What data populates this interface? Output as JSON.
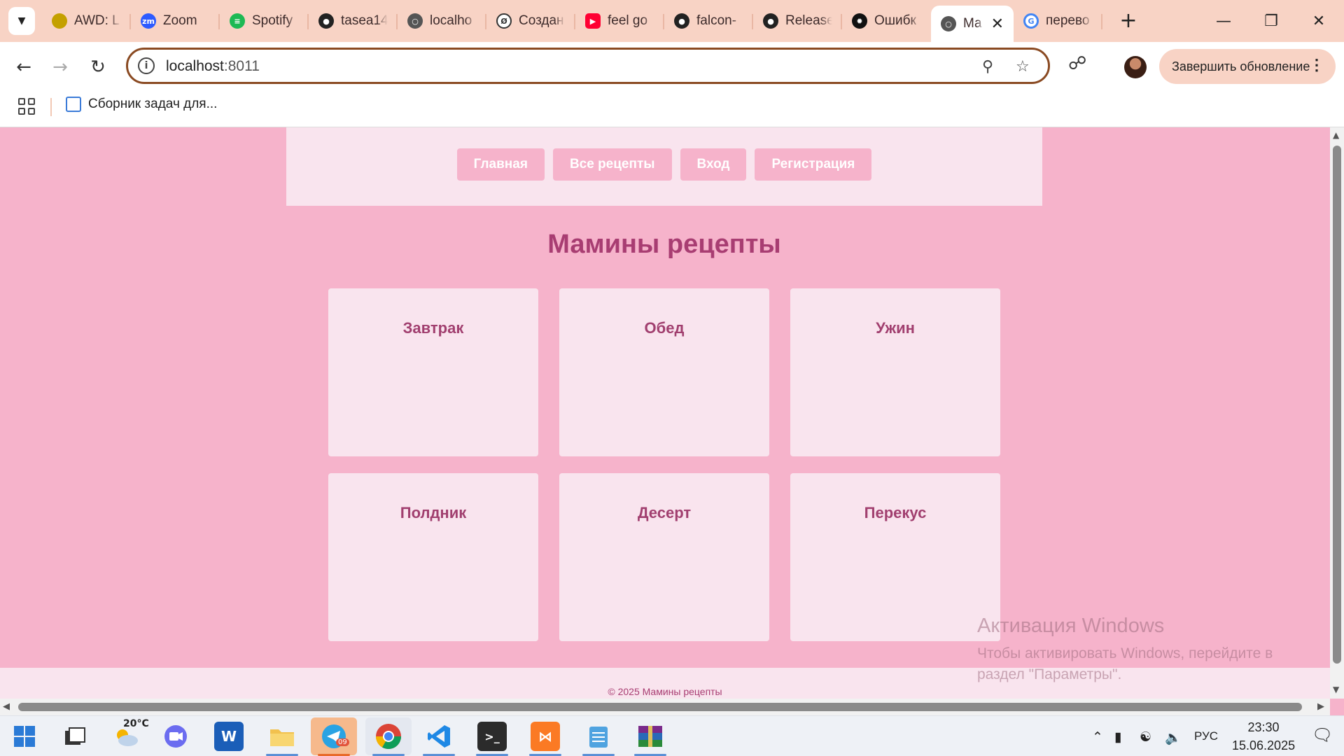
{
  "browser": {
    "tabs": [
      {
        "label": "AWD: L",
        "icon": "awd-icon",
        "color": "#c4a000"
      },
      {
        "label": "Zoom",
        "icon": "zoom-icon",
        "color": "#2d5bff"
      },
      {
        "label": "Spotify",
        "icon": "spotify-icon",
        "color": "#1db954"
      },
      {
        "label": "tasea14",
        "icon": "github-icon",
        "color": "#222222"
      },
      {
        "label": "localho",
        "icon": "globe-icon",
        "color": "#555555"
      },
      {
        "label": "Создан",
        "icon": "openai-like-icon",
        "color": "#333333"
      },
      {
        "label": "feel go",
        "icon": "youtube-icon",
        "color": "#ff0033"
      },
      {
        "label": "falcon-",
        "icon": "github-icon",
        "color": "#222222"
      },
      {
        "label": "Release",
        "icon": "github-icon",
        "color": "#222222"
      },
      {
        "label": "Ошибк",
        "icon": "chatgpt-icon",
        "color": "#111111"
      },
      {
        "label": "Ма",
        "icon": "globe-icon",
        "color": "#555555",
        "active": true
      },
      {
        "label": "перево",
        "icon": "google-icon",
        "color": "#4285f4"
      }
    ],
    "address": {
      "host": "localhost",
      "port": ":8011"
    },
    "update_button": "Завершить обновление",
    "bookmark": "Сборник задач для..."
  },
  "site": {
    "nav": [
      "Главная",
      "Все рецепты",
      "Вход",
      "Регистрация"
    ],
    "title": "Мамины рецепты",
    "categories": [
      "Завтрак",
      "Обед",
      "Ужин",
      "Полдник",
      "Десерт",
      "Перекус"
    ],
    "footer": "© 2025 Мамины рецепты",
    "colors": {
      "background": "#f6b3cb",
      "panel": "#f9e4ee",
      "accent": "#a83d72"
    }
  },
  "watermark": {
    "title": "Активация Windows",
    "text": "Чтобы активировать Windows, перейдите в раздел \"Параметры\"."
  },
  "taskbar": {
    "weather": "20°C",
    "telegram_badge": "09",
    "language": "РУС",
    "time": "23:30",
    "date": "15.06.2025"
  }
}
